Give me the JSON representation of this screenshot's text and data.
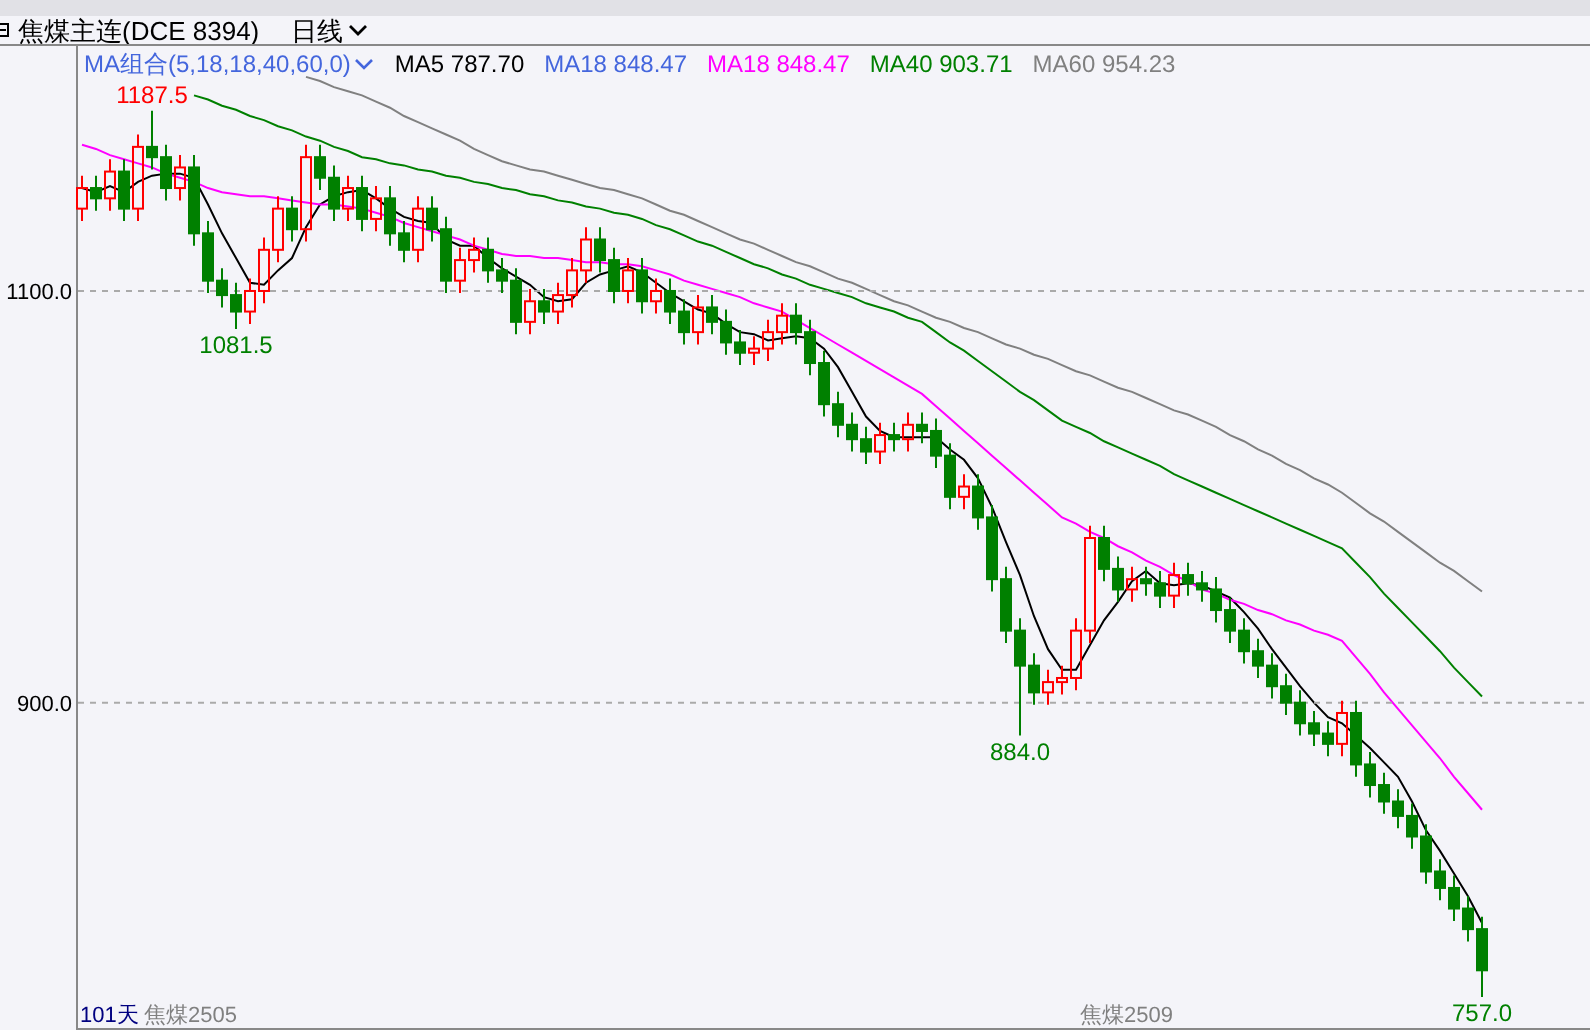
{
  "header": {
    "title": "焦煤主连(DCE 8394)",
    "period": "日线"
  },
  "legend": [
    {
      "kind": "menu",
      "text": "MA组合(5,18,18,40,60,0)",
      "color": "#4466dd"
    },
    {
      "kind": "series",
      "reading": "787.70"
    },
    {
      "kind": "plain",
      "text": "MA18 848.47",
      "color": "#4466dd"
    },
    {
      "kind": "series",
      "reading": "848.47"
    },
    {
      "kind": "series",
      "reading": "903.71"
    },
    {
      "kind": "series",
      "reading": "954.23"
    }
  ],
  "chart": {
    "chart_data": {
      "type": "candlestick",
      "ylim": [
        741,
        1219
      ],
      "yticks": [
        {
          "value": 900,
          "label": "900.0"
        },
        {
          "value": 1100,
          "label": "1100.0"
        }
      ],
      "ohlc": [
        [
          1140,
          1156,
          1134,
          1150
        ],
        [
          1150,
          1156,
          1139,
          1145
        ],
        [
          1145,
          1164,
          1139,
          1158
        ],
        [
          1158,
          1164,
          1134,
          1140
        ],
        [
          1140,
          1176,
          1134,
          1170
        ],
        [
          1170,
          1187.5,
          1159,
          1165
        ],
        [
          1165,
          1171,
          1144,
          1150
        ],
        [
          1150,
          1166,
          1144,
          1160
        ],
        [
          1160,
          1166,
          1122,
          1128
        ],
        [
          1128,
          1134,
          1099,
          1105
        ],
        [
          1105,
          1111,
          1092,
          1098
        ],
        [
          1098,
          1104,
          1081.5,
          1090
        ],
        [
          1090,
          1106,
          1084,
          1100
        ],
        [
          1100,
          1126,
          1094,
          1120
        ],
        [
          1120,
          1146,
          1114,
          1140
        ],
        [
          1140,
          1146,
          1124,
          1130
        ],
        [
          1130,
          1171,
          1124,
          1165
        ],
        [
          1165,
          1171,
          1149,
          1155
        ],
        [
          1155,
          1161,
          1134,
          1140
        ],
        [
          1140,
          1156,
          1134,
          1150
        ],
        [
          1150,
          1156,
          1129,
          1135
        ],
        [
          1135,
          1151,
          1129,
          1145
        ],
        [
          1145,
          1151,
          1122,
          1128
        ],
        [
          1128,
          1134,
          1114,
          1120
        ],
        [
          1120,
          1146,
          1114,
          1140
        ],
        [
          1140,
          1146,
          1124,
          1130
        ],
        [
          1130,
          1136,
          1099,
          1105
        ],
        [
          1105,
          1121,
          1099,
          1115
        ],
        [
          1115,
          1126,
          1109,
          1120
        ],
        [
          1120,
          1126,
          1104,
          1110
        ],
        [
          1110,
          1116,
          1099,
          1105
        ],
        [
          1105,
          1111,
          1079,
          1085
        ],
        [
          1085,
          1101,
          1079,
          1095
        ],
        [
          1095,
          1101,
          1084,
          1090
        ],
        [
          1090,
          1104,
          1084,
          1098
        ],
        [
          1098,
          1116,
          1092,
          1110
        ],
        [
          1110,
          1131,
          1104,
          1125
        ],
        [
          1125,
          1131,
          1109,
          1115
        ],
        [
          1115,
          1121,
          1094,
          1100
        ],
        [
          1100,
          1116,
          1094,
          1110
        ],
        [
          1110,
          1116,
          1089,
          1095
        ],
        [
          1095,
          1106,
          1089,
          1100
        ],
        [
          1100,
          1106,
          1084,
          1090
        ],
        [
          1090,
          1096,
          1074,
          1080
        ],
        [
          1080,
          1098,
          1074,
          1092
        ],
        [
          1092,
          1098,
          1079,
          1085
        ],
        [
          1085,
          1091,
          1069,
          1075
        ],
        [
          1075,
          1081,
          1064,
          1070
        ],
        [
          1070,
          1078,
          1064,
          1072
        ],
        [
          1072,
          1086,
          1066,
          1080
        ],
        [
          1080,
          1094,
          1074,
          1088
        ],
        [
          1088,
          1094,
          1074,
          1080
        ],
        [
          1080,
          1086,
          1059,
          1065
        ],
        [
          1065,
          1071,
          1039,
          1045
        ],
        [
          1045,
          1051,
          1029,
          1035
        ],
        [
          1035,
          1041,
          1022,
          1028
        ],
        [
          1028,
          1034,
          1016,
          1022
        ],
        [
          1022,
          1036,
          1016,
          1030
        ],
        [
          1030,
          1036,
          1022,
          1028
        ],
        [
          1028,
          1041,
          1022,
          1035
        ],
        [
          1035,
          1041,
          1026,
          1032
        ],
        [
          1032,
          1038,
          1014,
          1020
        ],
        [
          1020,
          1026,
          994,
          1000
        ],
        [
          1000,
          1011,
          994,
          1005
        ],
        [
          1005,
          1011,
          984,
          990
        ],
        [
          990,
          996,
          954,
          960
        ],
        [
          960,
          966,
          929,
          935
        ],
        [
          935,
          941,
          884,
          918
        ],
        [
          918,
          924,
          899,
          905
        ],
        [
          905,
          916,
          899,
          910
        ],
        [
          910,
          918,
          904,
          912
        ],
        [
          912,
          941,
          906,
          935
        ],
        [
          935,
          986,
          929,
          980
        ],
        [
          980,
          986,
          959,
          965
        ],
        [
          965,
          971,
          949,
          955
        ],
        [
          955,
          966,
          949,
          960
        ],
        [
          960,
          966,
          952,
          958
        ],
        [
          958,
          964,
          946,
          952
        ],
        [
          952,
          968,
          946,
          962
        ],
        [
          962,
          968,
          952,
          958
        ],
        [
          958,
          964,
          949,
          955
        ],
        [
          955,
          961,
          939,
          945
        ],
        [
          945,
          951,
          929,
          935
        ],
        [
          935,
          941,
          919,
          925
        ],
        [
          925,
          931,
          912,
          918
        ],
        [
          918,
          924,
          902,
          908
        ],
        [
          908,
          914,
          894,
          900
        ],
        [
          900,
          906,
          884,
          890
        ],
        [
          890,
          896,
          879,
          885
        ],
        [
          885,
          891,
          874,
          880
        ],
        [
          880,
          901,
          874,
          895
        ],
        [
          895,
          901,
          864,
          870
        ],
        [
          870,
          876,
          854,
          860
        ],
        [
          860,
          866,
          846,
          852
        ],
        [
          852,
          858,
          839,
          845
        ],
        [
          845,
          851,
          829,
          835
        ],
        [
          835,
          841,
          812,
          818
        ],
        [
          818,
          824,
          804,
          810
        ],
        [
          810,
          816,
          794,
          800
        ],
        [
          800,
          806,
          784,
          790
        ],
        [
          790,
          796,
          757,
          770
        ]
      ],
      "annotations": [
        "1187.5",
        "1081.5",
        "884.0",
        "757.0"
      ]
    },
    "overlay": {
      "chart_data": {
        "type": "line",
        "ylim": [
          741,
          1219
        ],
        "series": [
          {
            "name": "MA5",
            "color": "#000000",
            "values": [
              1150,
              1148,
              1151,
              1148,
              1153,
              1156,
              1157,
              1157,
              1155,
              1142,
              1128,
              1116,
              1104,
              1103,
              1110,
              1116,
              1131,
              1142,
              1146,
              1148,
              1149,
              1145,
              1140,
              1136,
              1134,
              1133,
              1125,
              1122,
              1122,
              1116,
              1111,
              1107,
              1103,
              1097,
              1095,
              1096,
              1104,
              1108,
              1110,
              1112,
              1109,
              1104,
              1099,
              1095,
              1091,
              1089,
              1084,
              1080,
              1079,
              1076,
              1077,
              1078,
              1077,
              1072,
              1063,
              1051,
              1039,
              1032,
              1029,
              1029,
              1029,
              1029,
              1023,
              1018,
              1009,
              995,
              978,
              962,
              942,
              926,
              916,
              916,
              928,
              940,
              949,
              959,
              964,
              958,
              957,
              958,
              957,
              954,
              951,
              944,
              936,
              926,
              917,
              908,
              900,
              893,
              890,
              884,
              878,
              871,
              864,
              852,
              838,
              828,
              817,
              806,
              793
            ]
          },
          {
            "name": "MA18",
            "color": "#ff00ff",
            "values": [
              1171,
              1169,
              1166,
              1164,
              1162,
              1160,
              1157,
              1155,
              1153,
              1150,
              1148,
              1147,
              1146,
              1146,
              1145,
              1144,
              1143,
              1142,
              1142,
              1141,
              1140,
              1138,
              1136,
              1133,
              1131,
              1129,
              1127,
              1125,
              1122,
              1120,
              1118,
              1117,
              1117,
              1116,
              1116,
              1115,
              1114,
              1114,
              1113,
              1113,
              1112,
              1110,
              1108,
              1105,
              1103,
              1101,
              1099,
              1097,
              1094,
              1092,
              1090,
              1086,
              1082,
              1078,
              1074,
              1070,
              1066,
              1062,
              1058,
              1054,
              1050,
              1044,
              1038,
              1032,
              1026,
              1020,
              1014,
              1008,
              1002,
              996,
              990,
              987,
              983,
              980,
              976,
              973,
              969,
              966,
              962,
              959,
              955,
              953,
              950,
              948,
              945,
              943,
              940,
              938,
              935,
              933,
              930,
              922,
              914,
              905,
              897,
              889,
              881,
              873,
              864,
              856,
              848
            ]
          },
          {
            "name": "MA40",
            "color": "#008000",
            "values": [
              null,
              null,
              null,
              null,
              null,
              null,
              null,
              null,
              1195,
              1193,
              1190,
              1188,
              1185,
              1183,
              1180,
              1178,
              1175,
              1173,
              1170,
              1168,
              1165,
              1164,
              1162,
              1161,
              1159,
              1158,
              1156,
              1155,
              1153,
              1152,
              1150,
              1149,
              1147,
              1146,
              1144,
              1143,
              1141,
              1140,
              1138,
              1137,
              1135,
              1132,
              1130,
              1127,
              1124,
              1122,
              1119,
              1116,
              1113,
              1111,
              1108,
              1106,
              1103,
              1101,
              1099,
              1097,
              1094,
              1092,
              1090,
              1087,
              1085,
              1080,
              1075,
              1071,
              1066,
              1061,
              1056,
              1051,
              1047,
              1042,
              1037,
              1034,
              1031,
              1027,
              1024,
              1021,
              1018,
              1015,
              1011,
              1008,
              1005,
              1002,
              999,
              996,
              993,
              990,
              987,
              984,
              981,
              978,
              975,
              968,
              961,
              953,
              946,
              939,
              932,
              925,
              917,
              910,
              903
            ]
          },
          {
            "name": "MA60",
            "color": "#808080",
            "values": [
              null,
              null,
              null,
              null,
              null,
              null,
              null,
              null,
              null,
              null,
              null,
              null,
              null,
              null,
              null,
              null,
              1204,
              1202,
              1199,
              1197,
              1195,
              1192,
              1189,
              1185,
              1182,
              1179,
              1176,
              1173,
              1169,
              1166,
              1163,
              1161,
              1159,
              1158,
              1156,
              1154,
              1152,
              1150,
              1149,
              1147,
              1145,
              1142,
              1139,
              1137,
              1134,
              1131,
              1128,
              1125,
              1123,
              1120,
              1117,
              1114,
              1112,
              1109,
              1106,
              1104,
              1101,
              1098,
              1095,
              1093,
              1090,
              1087,
              1085,
              1082,
              1080,
              1077,
              1074,
              1072,
              1069,
              1067,
              1064,
              1061,
              1059,
              1056,
              1053,
              1051,
              1048,
              1045,
              1042,
              1040,
              1037,
              1034,
              1030,
              1027,
              1023,
              1020,
              1016,
              1013,
              1009,
              1006,
              1002,
              997,
              992,
              988,
              983,
              978,
              973,
              968,
              964,
              959,
              954
            ]
          }
        ]
      }
    },
    "footer": [
      "101天",
      "焦煤2505",
      "焦煤2509"
    ]
  }
}
